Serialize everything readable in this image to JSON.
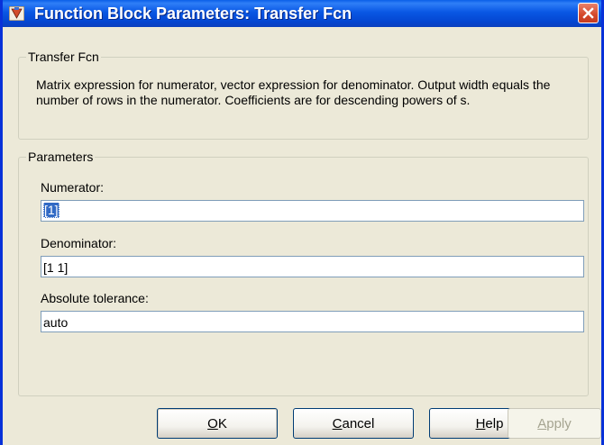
{
  "window": {
    "title": "Function Block Parameters: Transfer Fcn",
    "icon": "simulink-block-icon",
    "close_icon": "close-icon"
  },
  "block_group": {
    "legend": "Transfer Fcn",
    "description": "Matrix expression for numerator, vector expression for denominator.  Output width equals the number of rows in the numerator.  Coefficients are for descending powers of s."
  },
  "params_group": {
    "legend": "Parameters",
    "numerator": {
      "label": "Numerator:",
      "value": "[1]"
    },
    "denominator": {
      "label": "Denominator:",
      "value": "[1 1]"
    },
    "abs_tol": {
      "label": "Absolute tolerance:",
      "value": "auto"
    }
  },
  "buttons": {
    "ok": {
      "mnemonic": "O",
      "rest": "K"
    },
    "cancel": {
      "mnemonic": "C",
      "rest": "ancel"
    },
    "help": {
      "mnemonic": "H",
      "rest": "elp"
    },
    "apply": {
      "mnemonic": "A",
      "rest": "pply",
      "enabled": false
    }
  },
  "colors": {
    "title_bar": "#0a50d8",
    "dialog_bg": "#ece9d8",
    "close_button": "#d4482a",
    "selection": "#316ac5"
  }
}
